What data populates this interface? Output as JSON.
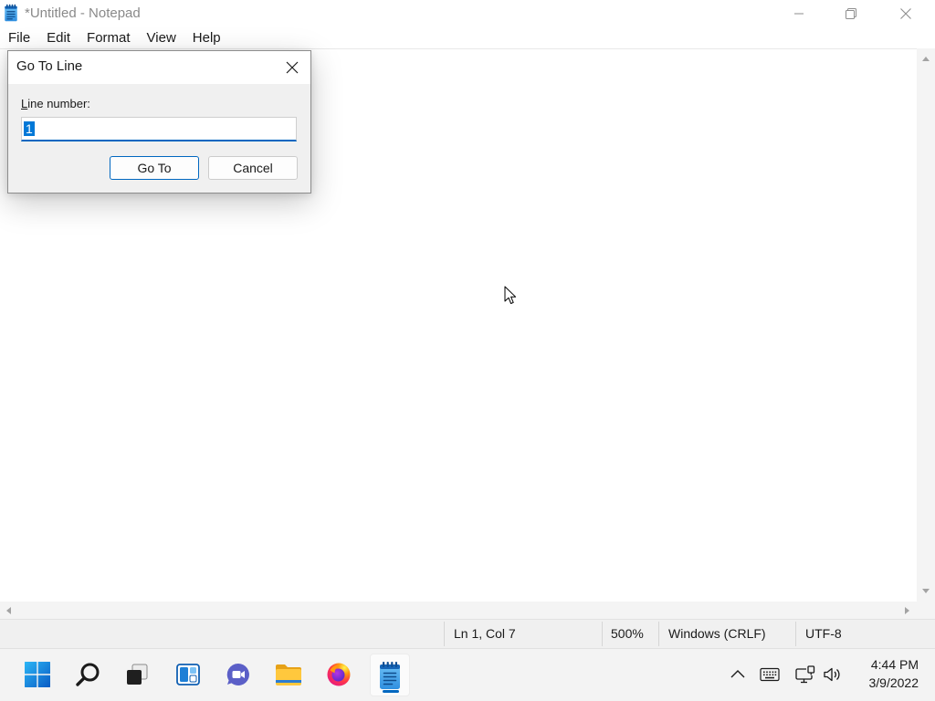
{
  "window": {
    "title": "*Untitled - Notepad",
    "icon": "notepad-icon",
    "controls": [
      "minimize-icon",
      "restore-icon",
      "close-icon"
    ]
  },
  "menu": {
    "items": [
      {
        "label": "File"
      },
      {
        "label": "Edit"
      },
      {
        "label": "Format"
      },
      {
        "label": "View"
      },
      {
        "label": "Help"
      }
    ]
  },
  "dialog": {
    "title": "Go To Line",
    "close_icon": "close-icon",
    "field_label": "Line number:",
    "line_number": "1",
    "line_number_selected": true,
    "buttons": {
      "goto": {
        "label": "Go To",
        "default": true
      },
      "cancel": {
        "label": "Cancel",
        "default": false
      }
    }
  },
  "scrollbars": {
    "vertical": {
      "up_icon": "scroll-up-arrow-icon",
      "down_icon": "scroll-down-arrow-icon"
    },
    "horizontal": {
      "left_icon": "scroll-left-arrow-icon",
      "right_icon": "scroll-right-arrow-icon"
    }
  },
  "status_bar": {
    "cursor_position": "Ln 1, Col 7",
    "zoom": "500%",
    "line_ending": "Windows (CRLF)",
    "encoding": "UTF-8"
  },
  "taskbar": {
    "apps": [
      {
        "icon": "start-icon"
      },
      {
        "icon": "search-icon"
      },
      {
        "icon": "task-view-icon"
      },
      {
        "icon": "widgets-icon"
      },
      {
        "icon": "chat-icon"
      },
      {
        "icon": "file-explorer-icon"
      },
      {
        "icon": "firefox-icon"
      },
      {
        "icon": "notepad-icon",
        "active": true
      }
    ],
    "tray": [
      "chevron-up-icon",
      "keyboard-icon",
      "network-icon",
      "volume-icon"
    ],
    "clock": {
      "time": "4:44 PM",
      "date": "3/9/2022"
    }
  },
  "pointer": {
    "icon": "arrow-pointer-icon"
  },
  "colors": {
    "accent": "#0067c0",
    "selection": "#0078d7",
    "title_inactive": "#8a8a8a",
    "dialog_body": "#f0f0f0",
    "status_bar_bg": "#f0f0f0",
    "taskbar_bg": "#f3f3f3"
  }
}
